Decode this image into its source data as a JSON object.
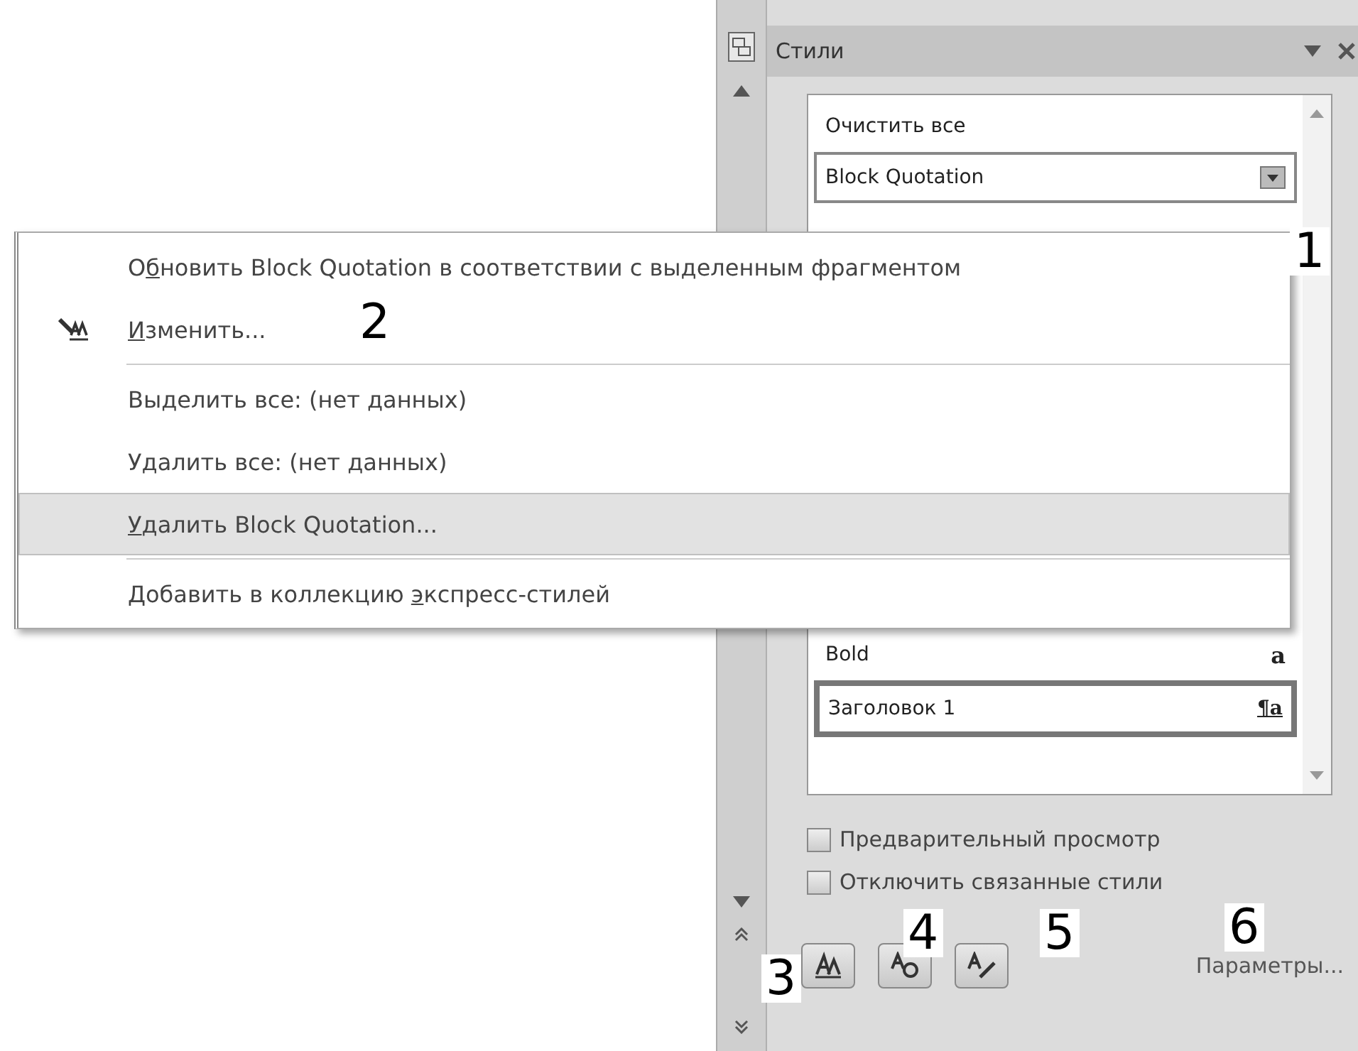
{
  "pane": {
    "title": "Стили",
    "styles": [
      {
        "name": "Очистить все",
        "hovered": false,
        "selected": false
      },
      {
        "name": "Block Quotation",
        "hovered": true,
        "selected": false
      }
    ],
    "styles_below_menu": [
      {
        "name": "Bold",
        "mark": "a",
        "kind": "char",
        "hovered": false,
        "selected": false
      },
      {
        "name": "Заголовок 1",
        "mark": "¶a",
        "kind": "linked",
        "hovered": false,
        "selected": true
      }
    ],
    "options": [
      {
        "label": "Предварительный просмотр",
        "checked": false
      },
      {
        "label": "Отключить связанные стили",
        "checked": false
      }
    ],
    "options_link": "Параметры..."
  },
  "context_menu": {
    "items": [
      {
        "before": "О",
        "key": "б",
        "after": "новить Block Quotation в соответствии с выделенным фрагментом",
        "kind": "plain",
        "selected": false,
        "divider_after": false
      },
      {
        "key": "И",
        "after": "зменить...",
        "kind": "with-icon",
        "selected": false,
        "divider_after": true
      },
      {
        "before": "Выделить все: (нет данных)",
        "kind": "plain",
        "selected": false,
        "divider_after": false
      },
      {
        "before": "Удалить все: (нет данных)",
        "kind": "plain",
        "selected": false,
        "divider_after": false
      },
      {
        "key": "У",
        "after": "далить Block Quotation...",
        "kind": "plain",
        "selected": true,
        "divider_after": true
      },
      {
        "before": "Добавить в коллекцию ",
        "key": "э",
        "after": "кспресс-стилей",
        "kind": "plain",
        "selected": false,
        "divider_after": false
      }
    ]
  },
  "callouts": [
    "1",
    "2",
    "3",
    "4",
    "5",
    "6"
  ]
}
